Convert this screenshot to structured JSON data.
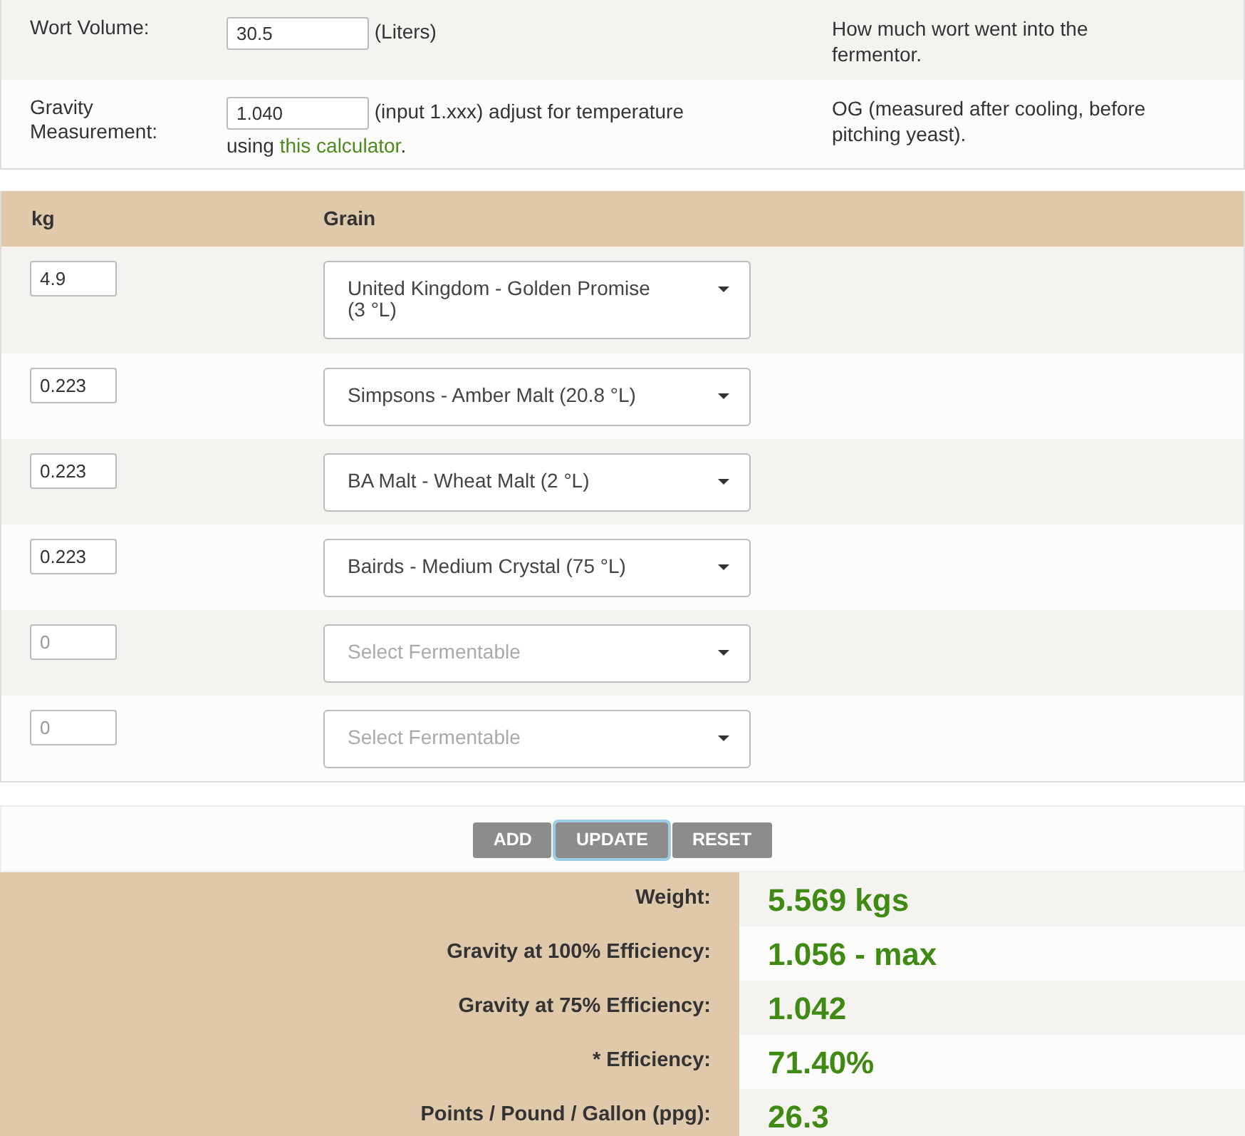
{
  "settings": [
    {
      "label": "Wort Volume:",
      "value": "30.5",
      "after": "(Liters)",
      "description": "How much wort went into the fermentor."
    },
    {
      "label": "Gravity Measurement:",
      "value": "1.040",
      "after": "(input 1.xxx) adjust for temperature",
      "link_before": "using",
      "link": "this calculator",
      "link_after": ".",
      "description": "OG (measured after cooling, before pitching yeast)."
    }
  ],
  "grain_table": {
    "columns": [
      "kg",
      "Grain"
    ],
    "rows": [
      {
        "kg": "4.9",
        "grain": "United Kingdom - Golden Promise (3 °L)"
      },
      {
        "kg": "0.223",
        "grain": "Simpsons - Amber Malt (20.8 °L)"
      },
      {
        "kg": "0.223",
        "grain": "BA Malt - Wheat Malt (2 °L)"
      },
      {
        "kg": "0.223",
        "grain": "Bairds - Medium Crystal (75 °L)"
      },
      {
        "kg_placeholder": "0",
        "grain_placeholder": "Select Fermentable"
      },
      {
        "kg_placeholder": "0",
        "grain_placeholder": "Select Fermentable"
      }
    ]
  },
  "buttons": [
    {
      "label": "ADD",
      "focused": false
    },
    {
      "label": "UPDATE",
      "focused": true
    },
    {
      "label": "RESET",
      "focused": false
    }
  ],
  "results": [
    {
      "label": "Weight:",
      "value": "5.569 kgs"
    },
    {
      "label": "Gravity at 100% Efficiency:",
      "value": "1.056 - max"
    },
    {
      "label": "Gravity at 75% Efficiency:",
      "value": "1.042"
    },
    {
      "label": "* Efficiency:",
      "value": "71.40%"
    },
    {
      "label": "Points / Pound / Gallon (ppg):",
      "value": "26.3"
    }
  ]
}
